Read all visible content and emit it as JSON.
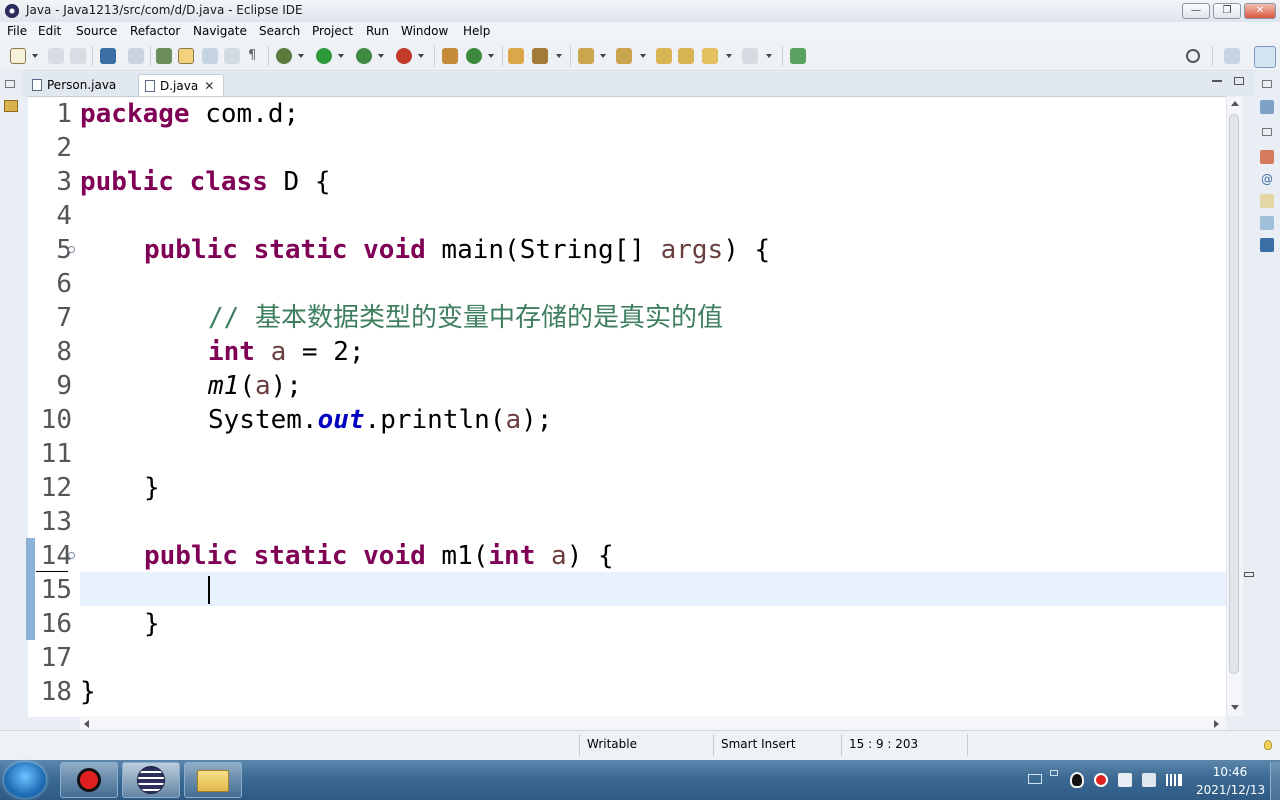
{
  "window": {
    "title": "Java - Java1213/src/com/d/D.java - Eclipse IDE",
    "min_glyph": "—",
    "max_glyph": "❐",
    "close_glyph": "✕"
  },
  "menu": [
    "File",
    "Edit",
    "Source",
    "Refactor",
    "Navigate",
    "Search",
    "Project",
    "Run",
    "Window",
    "Help"
  ],
  "tabs": [
    {
      "label": "Person.java",
      "active": false
    },
    {
      "label": "D.java",
      "active": true,
      "close": "✕"
    }
  ],
  "editor": {
    "line_numbers": [
      "1",
      "2",
      "3",
      "4",
      "5",
      "6",
      "7",
      "8",
      "9",
      "10",
      "11",
      "12",
      "13",
      "14",
      "15",
      "16",
      "17",
      "18"
    ],
    "tokens": {
      "l1_kw": "package",
      "l1_rest": " com.d;",
      "l3_kw1": "public",
      "l3_kw2": "class",
      "l3_rest": " D {",
      "l5_kw1": "public",
      "l5_kw2": "static",
      "l5_kw3": "void",
      "l5_mid": " main(String[] ",
      "l5_var": "args",
      "l5_end": ") {",
      "l7_cmt": "// 基本数据类型的变量中存储的是真实的值",
      "l8_kw": "int",
      "l8_var": "a",
      "l8_rest": " = 2;",
      "l9_call": "m1",
      "l9_open": "(",
      "l9_var": "a",
      "l9_close": ");",
      "l10_a": "System.",
      "l10_fld": "out",
      "l10_b": ".println(",
      "l10_var": "a",
      "l10_c": ");",
      "l12": "}",
      "l14_kw1": "public",
      "l14_kw2": "static",
      "l14_kw3": "void",
      "l14_mid": " m1(",
      "l14_kw4": "int",
      "l14_var": "a",
      "l14_end": ") {",
      "l16": "}",
      "l18": "}"
    }
  },
  "status": {
    "writable": "Writable",
    "insert_mode": "Smart Insert",
    "position": "15 : 9 : 203"
  },
  "taskbar": {
    "time": "10:46",
    "date": "2021/12/13"
  }
}
